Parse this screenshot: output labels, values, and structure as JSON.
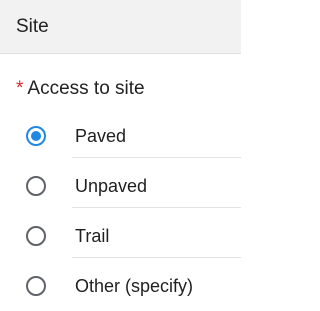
{
  "header": {
    "title": "Site"
  },
  "question": {
    "required_marker": "*",
    "label": "Access to site"
  },
  "options": [
    {
      "label": "Paved",
      "selected": true
    },
    {
      "label": "Unpaved",
      "selected": false
    },
    {
      "label": "Trail",
      "selected": false
    },
    {
      "label": "Other (specify)",
      "selected": false
    }
  ],
  "colors": {
    "accent": "#1e88e5",
    "required": "#d32f2f",
    "header_bg": "#f2f2f2"
  }
}
